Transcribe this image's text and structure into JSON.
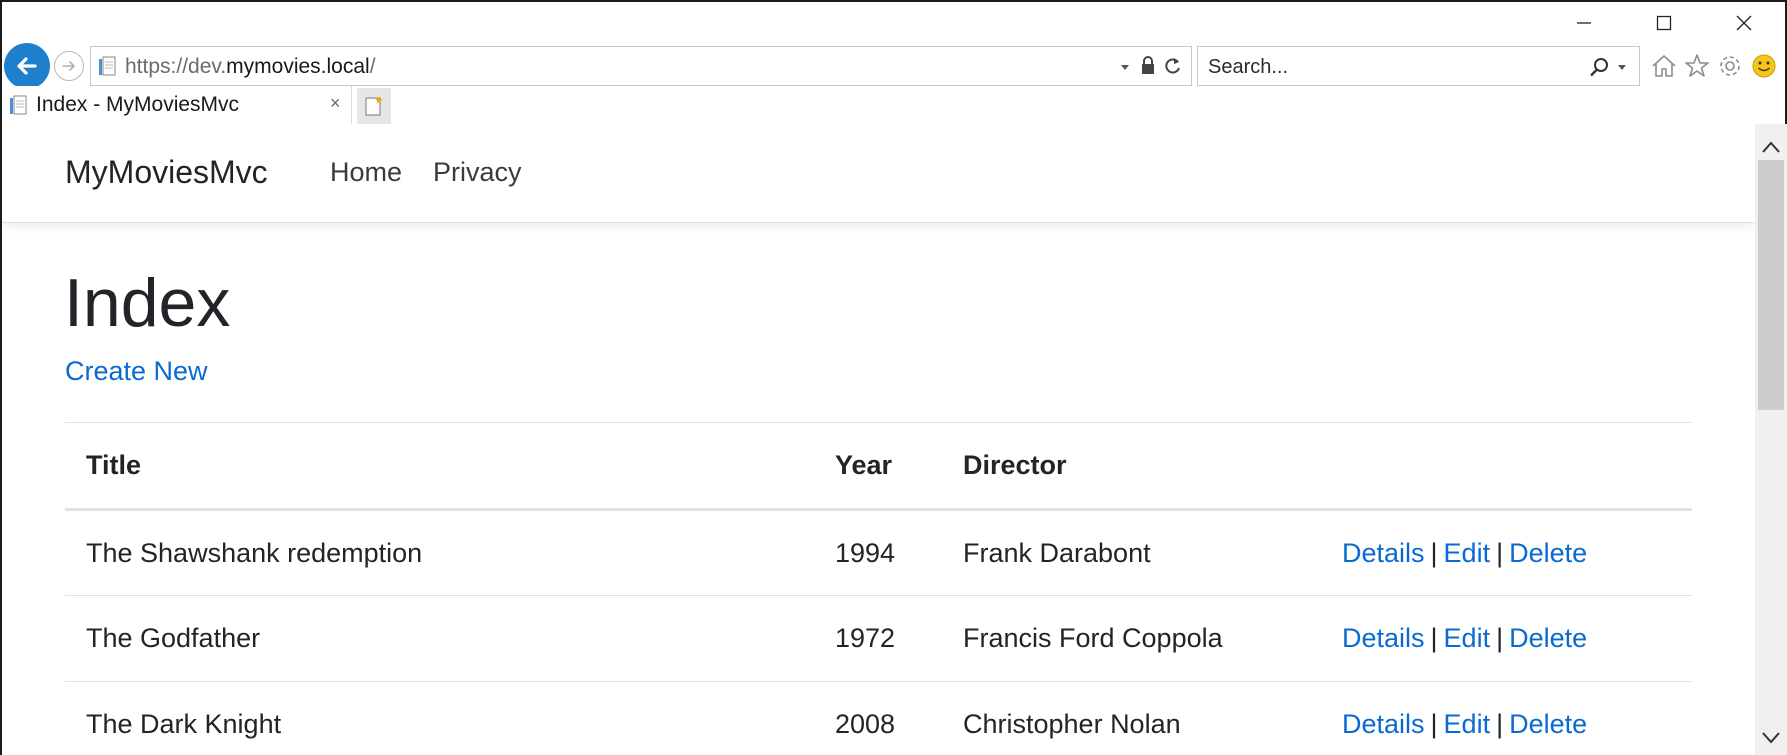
{
  "browser": {
    "address": {
      "prefix": "https://dev.",
      "host": "mymovies.local",
      "suffix": "/"
    },
    "search_placeholder": "Search...",
    "tab_title": "Index - MyMoviesMvc",
    "tab_close": "×",
    "accent": "#1e7fcc"
  },
  "navbar": {
    "brand": "MyMoviesMvc",
    "links": [
      "Home",
      "Privacy"
    ]
  },
  "page": {
    "title": "Index",
    "create_link": "Create New"
  },
  "table": {
    "headers": [
      "Title",
      "Year",
      "Director"
    ],
    "rows": [
      {
        "title": "The Shawshank redemption",
        "year": "1994",
        "director": "Frank Darabont"
      },
      {
        "title": "The Godfather",
        "year": "1972",
        "director": "Francis Ford Coppola"
      },
      {
        "title": "The Dark Knight",
        "year": "2008",
        "director": "Christopher Nolan"
      }
    ],
    "actions": {
      "details": "Details",
      "edit": "Edit",
      "delete": "Delete",
      "separator": "|"
    }
  },
  "colors": {
    "link": "#0a6ad1",
    "text": "#212529",
    "border": "#dee2e6"
  },
  "icons": [
    "back-arrow-icon",
    "forward-arrow-icon",
    "page-icon",
    "dropdown-icon",
    "lock-icon",
    "refresh-icon",
    "search-icon",
    "home-icon",
    "favorites-star-icon",
    "gear-icon",
    "smiley-icon",
    "new-tab-icon",
    "minimize-icon",
    "maximize-icon",
    "close-icon",
    "scroll-up-icon",
    "scroll-down-icon"
  ]
}
